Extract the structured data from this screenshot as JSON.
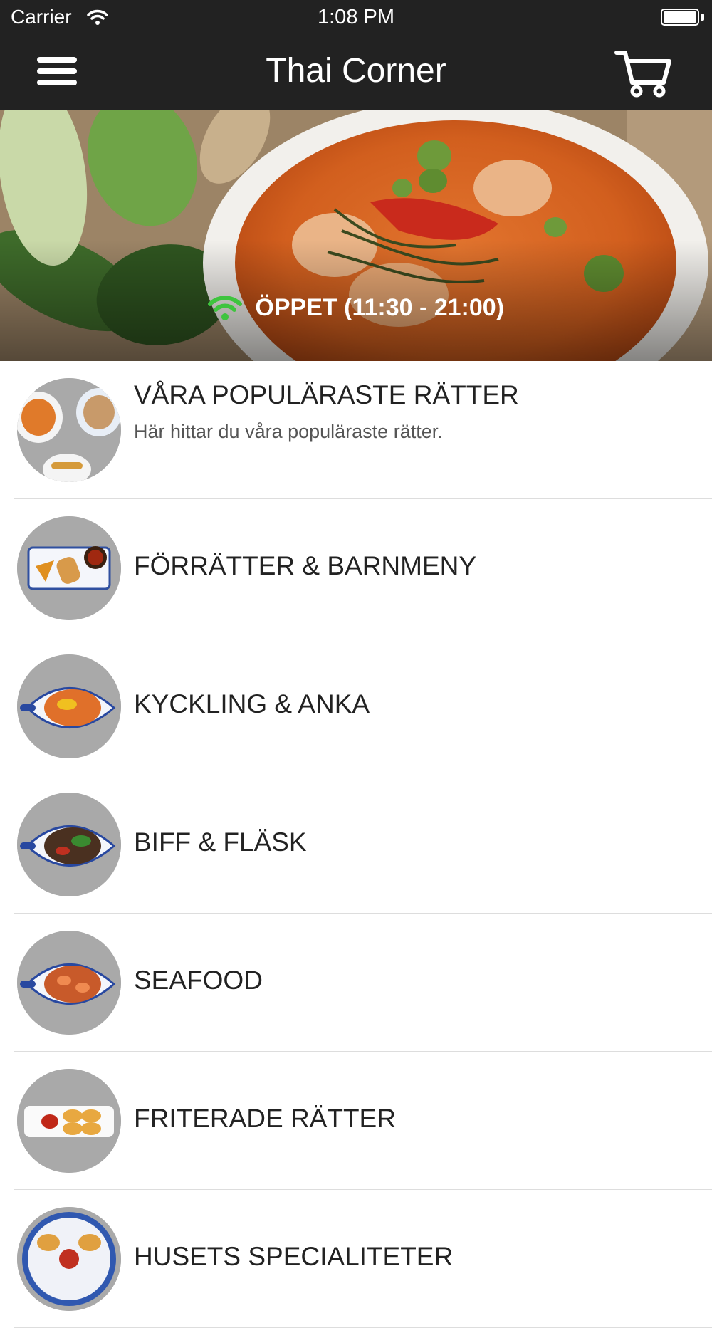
{
  "status_bar": {
    "carrier": "Carrier",
    "time": "1:08 PM"
  },
  "nav": {
    "title": "Thai Corner"
  },
  "hero": {
    "open_status": "ÖPPET (11:30 - 21:00)",
    "status_color": "#3ec43e"
  },
  "categories": [
    {
      "name": "VÅRA POPULÄRASTE RÄTTER",
      "description": "Här hittar du våra populäraste rätter."
    },
    {
      "name": "FÖRRÄTTER & BARNMENY"
    },
    {
      "name": "KYCKLING & ANKA"
    },
    {
      "name": "BIFF & FLÄSK"
    },
    {
      "name": "SEAFOOD"
    },
    {
      "name": "FRITERADE RÄTTER"
    },
    {
      "name": "HUSETS SPECIALITETER"
    }
  ]
}
